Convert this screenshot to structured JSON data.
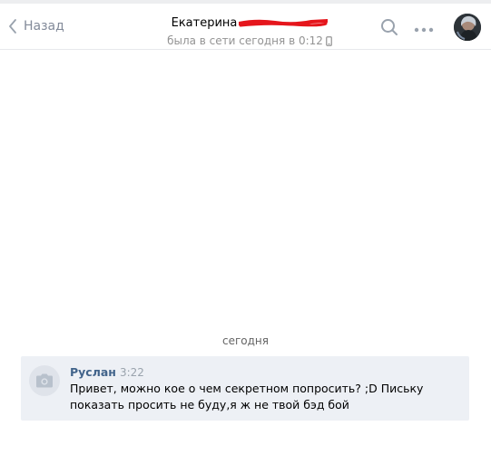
{
  "header": {
    "back_label": "Назад",
    "peer_name": "Екатерина",
    "peer_status": "была в сети сегодня в 0:12"
  },
  "icons": {
    "back": "chevron-left-icon",
    "search": "search-icon",
    "more": "more-horizontal-icon",
    "status_device": "mobile-phone-icon",
    "sender_avatar": "camera-icon"
  },
  "colors": {
    "accent": "#42648b",
    "message_bg": "#edf0f5",
    "redaction": "#e5161c"
  },
  "history": {
    "day_label": "сегодня",
    "messages": [
      {
        "author": "Руслан",
        "time": "3:22",
        "text": "Привет, можно кое о чем секретном попросить? ;D Письку показать просить не буду,я ж не твой бэд бой"
      }
    ]
  }
}
